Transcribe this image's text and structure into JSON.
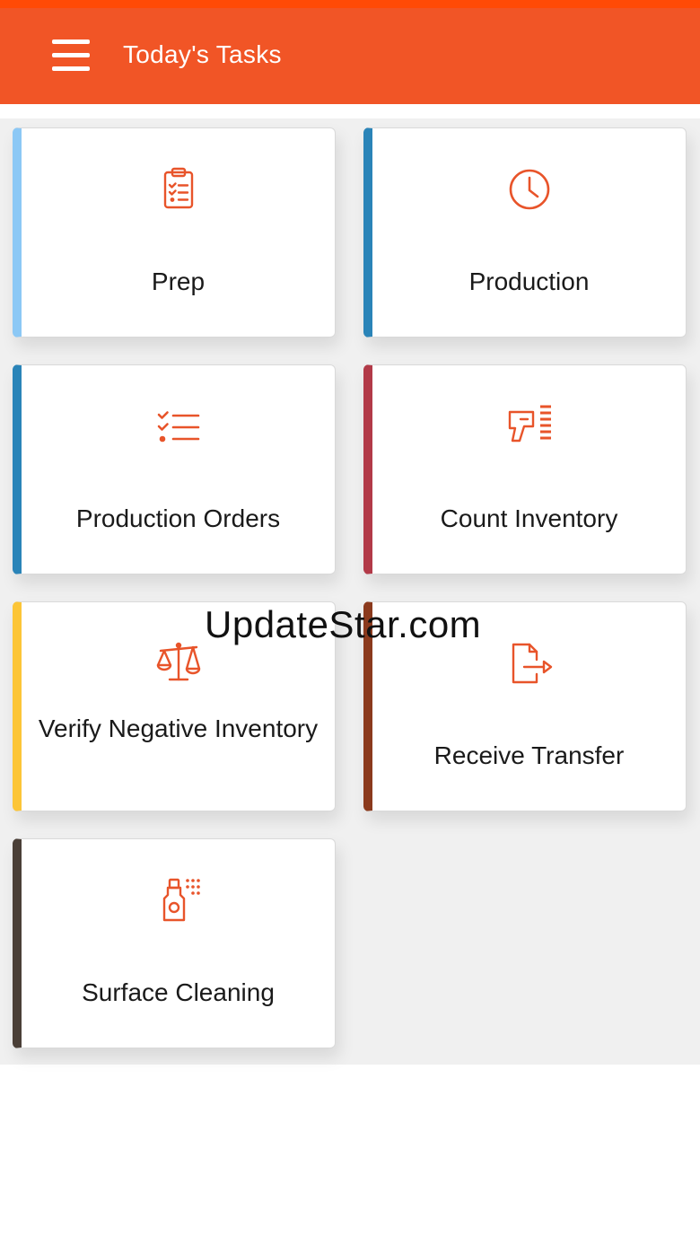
{
  "header": {
    "title": "Today's Tasks",
    "menu_icon": "hamburger-menu-icon"
  },
  "colors": {
    "status_bar": "#ff4a06",
    "app_bar": "#f15526",
    "icon": "#e8542a",
    "grid_bg": "#f0f0f0"
  },
  "tiles": [
    {
      "label": "Prep",
      "icon": "clipboard-checklist-icon",
      "accent": "#8cc8f5"
    },
    {
      "label": "Production",
      "icon": "clock-icon",
      "accent": "#2a84b8"
    },
    {
      "label": "Production Orders",
      "icon": "checklist-icon",
      "accent": "#2a84b8"
    },
    {
      "label": "Count Inventory",
      "icon": "barcode-scanner-icon",
      "accent": "#b23a48"
    },
    {
      "label": "Verify Negative Inventory",
      "icon": "balance-scale-icon",
      "accent": "#fcc537"
    },
    {
      "label": "Receive Transfer",
      "icon": "document-transfer-icon",
      "accent": "#8b3a1d"
    },
    {
      "label": "Surface Cleaning",
      "icon": "spray-bottle-icon",
      "accent": "#4a3f37"
    }
  ],
  "watermark": "UpdateStar.com"
}
